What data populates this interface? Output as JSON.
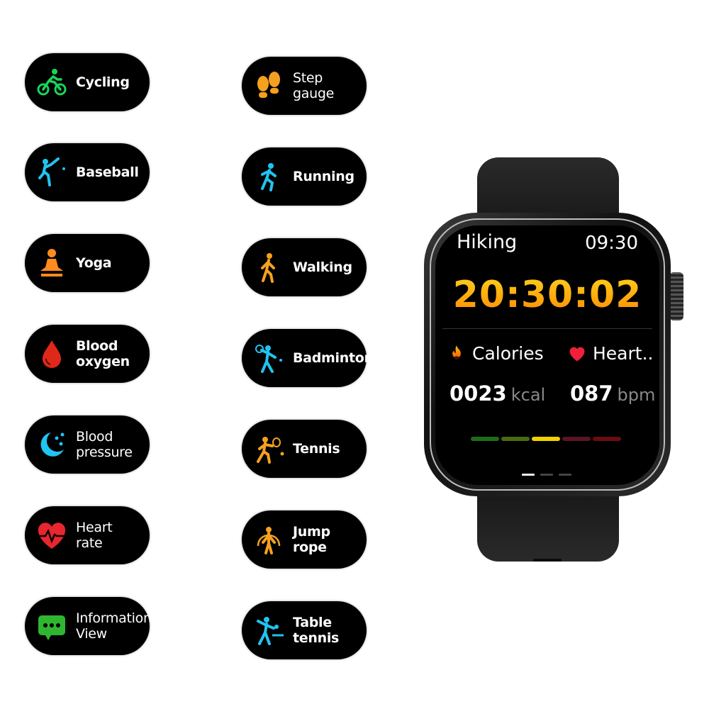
{
  "features_left": [
    {
      "label": "Cycling",
      "icon": "cycling-icon",
      "color": "#19d45a"
    },
    {
      "label": "Baseball",
      "icon": "baseball-icon",
      "color": "#20c4f0"
    },
    {
      "label": "Yoga",
      "icon": "yoga-icon",
      "color": "#ff8a1e"
    },
    {
      "label": "Blood\noxygen",
      "icon": "blood-drop-icon",
      "color": "#e0281a"
    },
    {
      "label": "Blood\npressure",
      "icon": "moon-stars-icon",
      "color": "#20c4f0"
    },
    {
      "label": "Heart\nrate",
      "icon": "heart-rate-icon",
      "color": "#e8262e"
    },
    {
      "label": "Information\nView",
      "icon": "message-icon",
      "color": "#2fb52f"
    }
  ],
  "features_right": [
    {
      "label": "Step\ngauge",
      "icon": "footsteps-icon",
      "color": "#f5a11f"
    },
    {
      "label": "Running",
      "icon": "running-icon",
      "color": "#20c4f0"
    },
    {
      "label": "Walking",
      "icon": "walking-icon",
      "color": "#f5a11f"
    },
    {
      "label": "Badminton",
      "icon": "badminton-icon",
      "color": "#20c4f0"
    },
    {
      "label": "Tennis",
      "icon": "tennis-icon",
      "color": "#f5a11f"
    },
    {
      "label": "Jump rope",
      "icon": "jump-rope-icon",
      "color": "#f5a11f"
    },
    {
      "label": "Table\ntennis",
      "icon": "table-tennis-icon",
      "color": "#20c4f0"
    }
  ],
  "watch": {
    "activity": "Hiking",
    "clock": "09:30",
    "timer": "20:30:02",
    "calories": {
      "label": "Calories",
      "value": "0023",
      "unit": "kcal",
      "icon": "flame-icon"
    },
    "heart": {
      "label": "Heart..",
      "value": "087",
      "unit": "bpm",
      "icon": "heart-icon"
    },
    "zones": [
      "#1f6b1a",
      "#4a6a12",
      "#f0d200",
      "#5a1424",
      "#6a0d10"
    ],
    "active_zone": 3,
    "pages": 3,
    "active_page": 1
  }
}
